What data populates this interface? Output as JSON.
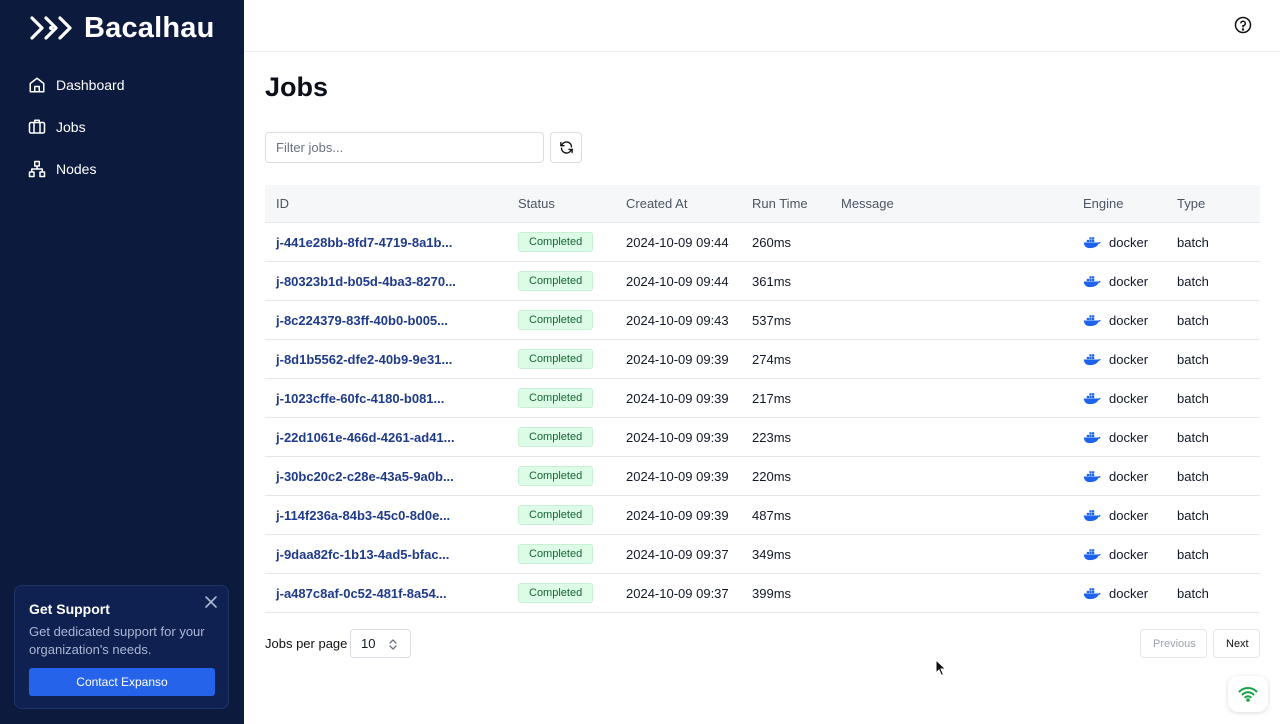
{
  "app": {
    "name": "Bacalhau"
  },
  "sidebar": {
    "items": [
      {
        "label": "Dashboard",
        "icon": "home-icon"
      },
      {
        "label": "Jobs",
        "icon": "jobs-icon"
      },
      {
        "label": "Nodes",
        "icon": "nodes-icon"
      }
    ],
    "support": {
      "title": "Get Support",
      "text": "Get dedicated support for your organization's needs.",
      "button_label": "Contact Expanso"
    }
  },
  "page": {
    "title": "Jobs",
    "filter_placeholder": "Filter jobs..."
  },
  "table": {
    "columns": [
      "ID",
      "Status",
      "Created At",
      "Run Time",
      "Message",
      "Engine",
      "Type"
    ],
    "rows": [
      {
        "id": "j-441e28bb-8fd7-4719-8a1b...",
        "status": "Completed",
        "created": "2024-10-09 09:44",
        "runtime": "260ms",
        "message": "",
        "engine": "docker",
        "type": "batch"
      },
      {
        "id": "j-80323b1d-b05d-4ba3-8270...",
        "status": "Completed",
        "created": "2024-10-09 09:44",
        "runtime": "361ms",
        "message": "",
        "engine": "docker",
        "type": "batch"
      },
      {
        "id": "j-8c224379-83ff-40b0-b005...",
        "status": "Completed",
        "created": "2024-10-09 09:43",
        "runtime": "537ms",
        "message": "",
        "engine": "docker",
        "type": "batch"
      },
      {
        "id": "j-8d1b5562-dfe2-40b9-9e31...",
        "status": "Completed",
        "created": "2024-10-09 09:39",
        "runtime": "274ms",
        "message": "",
        "engine": "docker",
        "type": "batch"
      },
      {
        "id": "j-1023cffe-60fc-4180-b081...",
        "status": "Completed",
        "created": "2024-10-09 09:39",
        "runtime": "217ms",
        "message": "",
        "engine": "docker",
        "type": "batch"
      },
      {
        "id": "j-22d1061e-466d-4261-ad41...",
        "status": "Completed",
        "created": "2024-10-09 09:39",
        "runtime": "223ms",
        "message": "",
        "engine": "docker",
        "type": "batch"
      },
      {
        "id": "j-30bc20c2-c28e-43a5-9a0b...",
        "status": "Completed",
        "created": "2024-10-09 09:39",
        "runtime": "220ms",
        "message": "",
        "engine": "docker",
        "type": "batch"
      },
      {
        "id": "j-114f236a-84b3-45c0-8d0e...",
        "status": "Completed",
        "created": "2024-10-09 09:39",
        "runtime": "487ms",
        "message": "",
        "engine": "docker",
        "type": "batch"
      },
      {
        "id": "j-9daa82fc-1b13-4ad5-bfac...",
        "status": "Completed",
        "created": "2024-10-09 09:37",
        "runtime": "349ms",
        "message": "",
        "engine": "docker",
        "type": "batch"
      },
      {
        "id": "j-a487c8af-0c52-481f-8a54...",
        "status": "Completed",
        "created": "2024-10-09 09:37",
        "runtime": "399ms",
        "message": "",
        "engine": "docker",
        "type": "batch"
      }
    ]
  },
  "pagination": {
    "per_page_label": "Jobs per page",
    "per_page_value": "10",
    "previous_label": "Previous",
    "next_label": "Next"
  },
  "colors": {
    "sidebar_bg": "#0c1a3d",
    "accent": "#2563eb",
    "status_completed_bg": "#dcfce7",
    "status_completed_text": "#166534",
    "docker_blue": "#1d63ed"
  }
}
